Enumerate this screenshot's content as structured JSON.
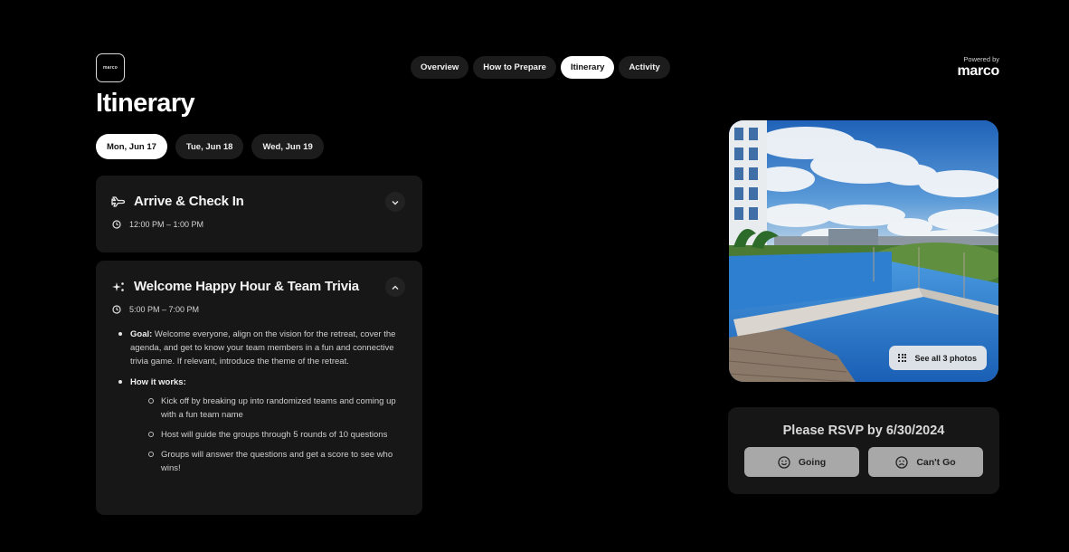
{
  "brand": {
    "logo_text": "marco",
    "powered_by_label": "Powered by",
    "powered_by_brand": "marco"
  },
  "nav": {
    "tabs": [
      {
        "label": "Overview",
        "active": false
      },
      {
        "label": "How to Prepare",
        "active": false
      },
      {
        "label": "Itinerary",
        "active": true
      },
      {
        "label": "Activity",
        "active": false
      }
    ]
  },
  "page": {
    "title": "Itinerary"
  },
  "days": [
    {
      "label": "Mon, Jun 17",
      "active": true
    },
    {
      "label": "Tue, Jun 18",
      "active": false
    },
    {
      "label": "Wed, Jun 19",
      "active": false
    }
  ],
  "events": [
    {
      "icon": "plane-icon",
      "title": "Arrive & Check In",
      "time": "12:00 PM – 1:00 PM",
      "expanded": false,
      "toggle_icon": "chevron-down-icon"
    },
    {
      "icon": "sparkles-icon",
      "title": "Welcome Happy Hour & Team Trivia",
      "time": "5:00 PM – 7:00 PM",
      "expanded": true,
      "toggle_icon": "chevron-up-icon",
      "goal_label": "Goal:",
      "goal_text": " Welcome everyone, align on the vision for the retreat, cover the agenda, and get to know your team members in a fun and connective trivia game. If relevant, introduce the theme of the retreat.",
      "how_label": "How it works:",
      "steps": [
        "Kick off by breaking up into randomized teams and coming up with a fun team name",
        "Host will guide the groups through 5 rounds of 10 questions",
        "Groups will answer the questions and get a score to see who wins!"
      ]
    }
  ],
  "photo": {
    "description": "Rooftop infinity pool with city skyline and cloudy blue sky",
    "see_all_label": "See all 3 photos",
    "count": 3
  },
  "rsvp": {
    "prompt": "Please RSVP by 6/30/2024",
    "going_label": "Going",
    "cant_go_label": "Can't Go"
  }
}
